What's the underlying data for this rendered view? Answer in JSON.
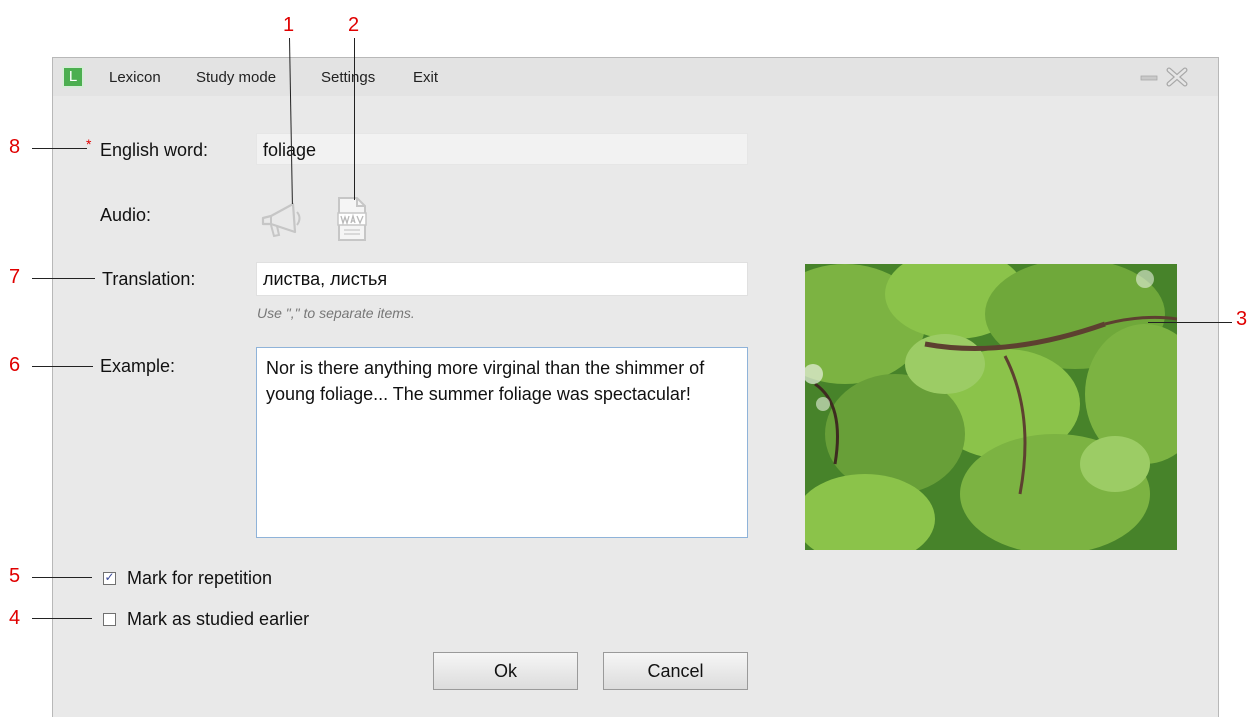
{
  "menu": {
    "logo_letter": "L",
    "items": [
      "Lexicon",
      "Study mode",
      "Settings",
      "Exit"
    ]
  },
  "form": {
    "required_marker": "*",
    "english_word_label": "English word:",
    "english_word_value": "foliage",
    "audio_label": "Audio:",
    "translation_label": "Translation:",
    "translation_value": "листва, листья",
    "translation_hint": "Use \",\" to separate items.",
    "example_label": "Example:",
    "example_value": "Nor is there anything more virginal than the shimmer of young foliage... The summer foliage was spectacular!",
    "mark_repetition_label": "Mark for repetition",
    "mark_repetition_checked": true,
    "mark_studied_label": "Mark as studied earlier",
    "mark_studied_checked": false,
    "check_glyph": "✓",
    "ok_label": "Ok",
    "cancel_label": "Cancel"
  },
  "callouts": [
    "1",
    "2",
    "3",
    "4",
    "5",
    "6",
    "7",
    "8"
  ],
  "icons": {
    "audio_play": "megaphone-icon",
    "audio_file": "wav-file-icon",
    "minimize": "minimize-icon",
    "close": "close-icon"
  },
  "colors": {
    "accent_logo": "#4caf50",
    "callout": "#e00000",
    "window_bg": "#e9e9e9"
  }
}
